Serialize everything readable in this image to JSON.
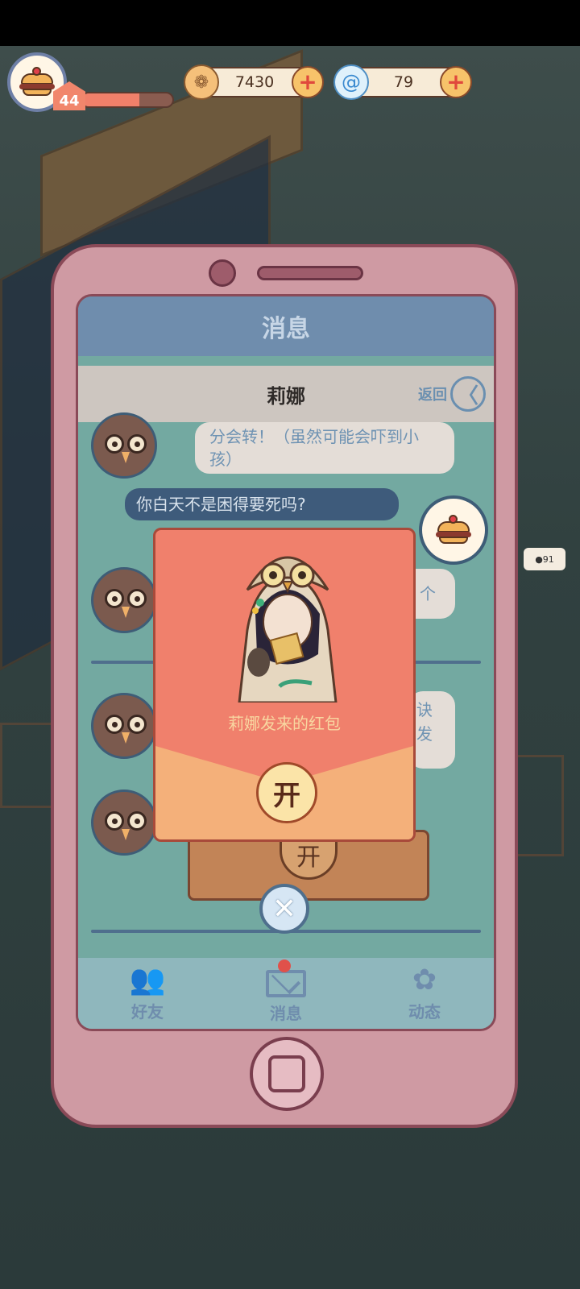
{
  "hud": {
    "level": "44",
    "xp_fraction": 0.63,
    "coins": "7430",
    "gems": "79",
    "coin_icon": "coin-icon",
    "gem_icon": "swirl-gem-icon"
  },
  "scene": {
    "sign_value": "91"
  },
  "phone": {
    "header_title": "消息",
    "chat_title": "莉娜",
    "back_label": "返回",
    "back_glyph": "〈",
    "messages": [
      {
        "side": "left",
        "text": "分会转！（虽然可能会吓到小孩）"
      },
      {
        "side": "right",
        "text": "你白天不是困得要死吗?"
      },
      {
        "side": "left",
        "text": "个"
      },
      {
        "side": "left",
        "text": "诀发"
      }
    ],
    "nav": [
      {
        "label": "好友",
        "icon": "friends-icon"
      },
      {
        "label": "消息",
        "icon": "mail-icon",
        "badge": true
      },
      {
        "label": "动态",
        "icon": "moments-icon"
      }
    ]
  },
  "envelope": {
    "title": "莉娜发来的红包",
    "open_label": "开",
    "background_open_label": "开",
    "close_glyph": "✕"
  },
  "colors": {
    "envelope": "#f0806c",
    "envelope_flap": "#f4b07a",
    "phone": "#cf9aa3",
    "header": "#6f8dad",
    "accent_red": "#e0514a"
  }
}
